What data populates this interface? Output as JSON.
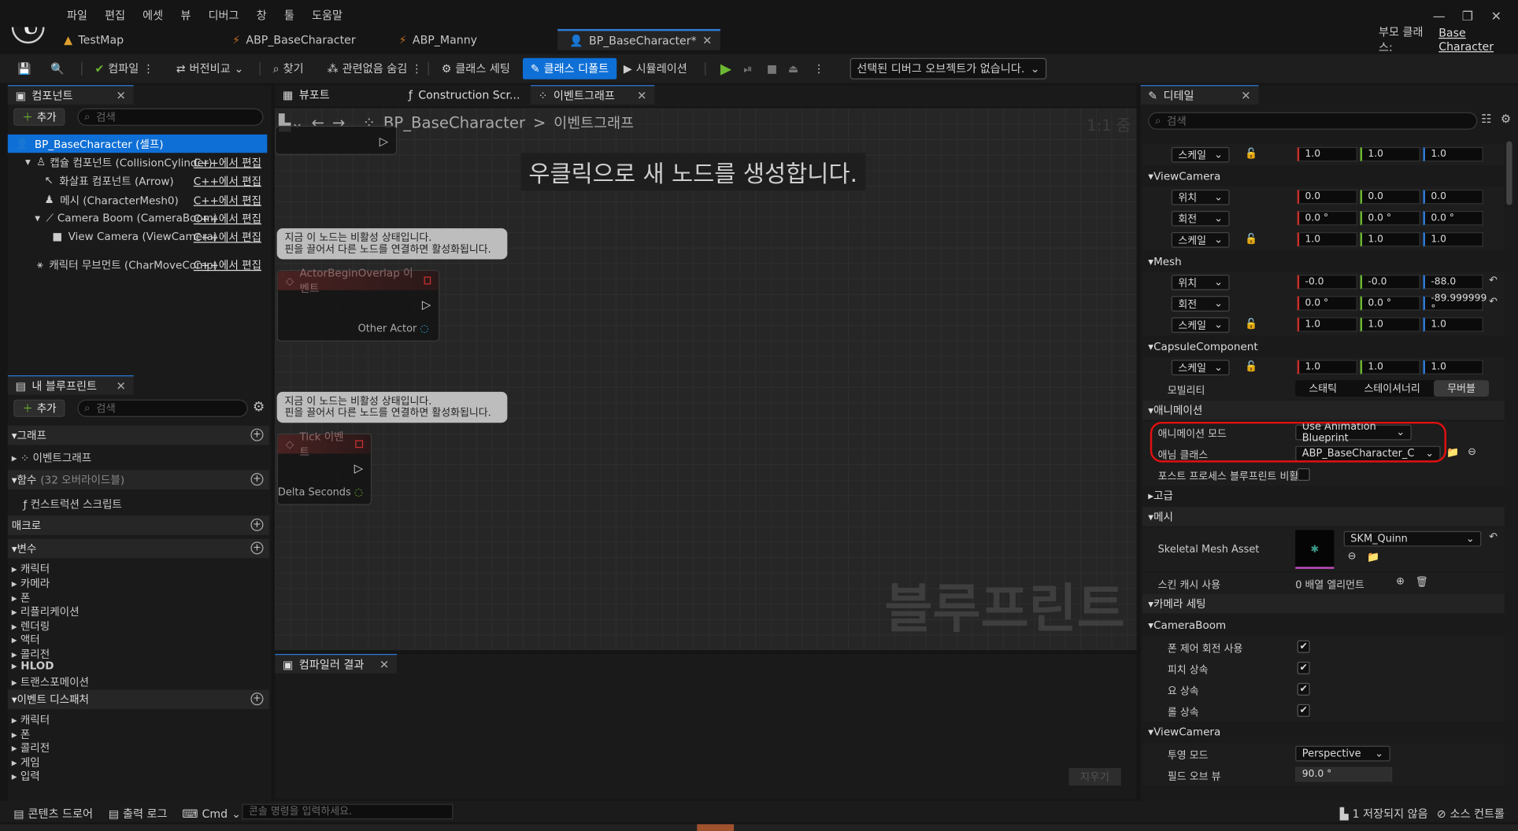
{
  "menu": [
    "파일",
    "편집",
    "에셋",
    "뷰",
    "디버그",
    "창",
    "툴",
    "도움말"
  ],
  "tabs": [
    {
      "label": "TestMap"
    },
    {
      "label": "ABP_BaseCharacter"
    },
    {
      "label": "ABP_Manny"
    },
    {
      "label": "BP_BaseCharacter*"
    }
  ],
  "parent_class": {
    "label": "부모 클래스:",
    "value": "Base Character"
  },
  "toolbar": {
    "compile": "컴파일",
    "diff": "버전비교",
    "find": "찾기",
    "hide_unrelated": "관련없음 숨김",
    "class_settings": "클래스 세팅",
    "class_defaults": "클래스 디폴트",
    "simulation": "시뮬레이션",
    "debug_object": "선택된 디버그 오브젝트가 없습니다."
  },
  "components": {
    "tab": "컴포넌트",
    "add": "추가",
    "search": "검색",
    "items": [
      {
        "label": "BP_BaseCharacter (셀프)",
        "edit": ""
      },
      {
        "label": "캡슐 컴포넌트 (CollisionCylinder)",
        "edit": "C++에서 편집"
      },
      {
        "label": "화살표 컴포넌트 (Arrow)",
        "edit": "C++에서 편집"
      },
      {
        "label": "메시 (CharacterMesh0)",
        "edit": "C++에서 편집"
      },
      {
        "label": "Camera Boom (CameraBoom)",
        "edit": "C++에서 편집"
      },
      {
        "label": "View Camera (ViewCamera)",
        "edit": "C++에서 편집"
      },
      {
        "label": "캐릭터 무브먼트 (CharMoveComp)",
        "edit": "C++에서 편집"
      }
    ]
  },
  "my_blueprint": {
    "tab": "내 블루프린트",
    "add": "추가",
    "search": "검색",
    "graph_section": "그래프",
    "graph_item": "이벤트그래프",
    "functions_section": "함수",
    "functions_count": "(32 오버라이드블)",
    "function_item": "컨스트럭션 스크립트",
    "macros_section": "매크로",
    "variables_section": "변수",
    "variables": [
      "캐릭터",
      "카메라",
      "폰",
      "리플리케이션",
      "렌더링",
      "액터",
      "콜리전",
      "HLOD",
      "트랜스포메이션"
    ],
    "dispatchers_section": "이벤트 디스패처",
    "dispatchers": [
      "캐릭터",
      "폰",
      "콜리전",
      "게임",
      "입력"
    ]
  },
  "editor_tabs": [
    "뷰포트",
    "Construction Scr...",
    "이벤트그래프"
  ],
  "graph": {
    "breadcrumb_root": "BP_BaseCharacter",
    "breadcrumb_sep": ">",
    "breadcrumb_leaf": "이벤트그래프",
    "zoom": "1:1 줌",
    "hint": "우클릭으로 새 노드를 생성합니다.",
    "watermark": "블루프린트",
    "comment1": "지금 이 노드는 비활성 상태입니다.",
    "comment2": "핀을 끌어서 다른 노드를 연결하면 활성화됩니다.",
    "node1_title": "ActorBeginOverlap 이벤트",
    "node1_pin": "Other Actor",
    "node2_title": "Tick 이벤트",
    "node2_pin": "Delta Seconds"
  },
  "compiler": {
    "tab": "컴파일러 결과",
    "clear": "지우기"
  },
  "details": {
    "tab": "디테일",
    "search": "검색",
    "scale": "스케일",
    "location": "위치",
    "rotation": "회전",
    "root_scale": [
      "1.0",
      "1.0",
      "1.0"
    ],
    "view_camera": "ViewCamera",
    "vc_loc": [
      "0.0",
      "0.0",
      "0.0"
    ],
    "vc_rot": [
      "0.0 °",
      "0.0 °",
      "0.0 °"
    ],
    "vc_scale": [
      "1.0",
      "1.0",
      "1.0"
    ],
    "mesh": "Mesh",
    "mesh_loc": [
      "-0.0",
      "-0.0",
      "-88.0"
    ],
    "mesh_rot": [
      "0.0 °",
      "0.0 °",
      "-89.999999 °"
    ],
    "mesh_scale": [
      "1.0",
      "1.0",
      "1.0"
    ],
    "capsule": "CapsuleComponent",
    "cap_scale": [
      "1.0",
      "1.0",
      "1.0"
    ],
    "mobility": "모빌리티",
    "mobility_opts": [
      "스태틱",
      "스테이셔너리",
      "무버블"
    ],
    "animation": "애니메이션",
    "anim_mode_label": "애니메이션 모드",
    "anim_mode": "Use Animation Blueprint",
    "anim_class_label": "애님 클래스",
    "anim_class": "ABP_BaseCharacter_C",
    "post_process": "포스트 프로세스 블루프린트 비활...",
    "advanced": "고급",
    "mesh_section": "메시",
    "skeletal_mesh_label": "Skeletal Mesh Asset",
    "skeletal_mesh": "SKM_Quinn",
    "skin_cache": "스킨 캐시 사용",
    "skin_cache_val": "0 배열 엘리먼트",
    "camera_settings": "카메라 세팅",
    "camera_boom": "CameraBoom",
    "cb_items": [
      "폰 제어 회전 사용",
      "피치 상속",
      "요 상속",
      "롤 상속"
    ],
    "view_camera2": "ViewCamera",
    "projection_label": "투영 모드",
    "projection": "Perspective",
    "fov_label": "필드 오브 뷰",
    "fov": "90.0 °"
  },
  "bottom": {
    "content_drawer": "콘텐츠 드로어",
    "output_log": "출력 로그",
    "cmd": "Cmd",
    "console_placeholder": "콘솔 명령을 입력하세요.",
    "unsaved": "1 저장되지 않음",
    "source_control": "소스 컨트롤"
  },
  "colors": {
    "accent": "#0e6fd6",
    "annotation": "#e01010"
  }
}
